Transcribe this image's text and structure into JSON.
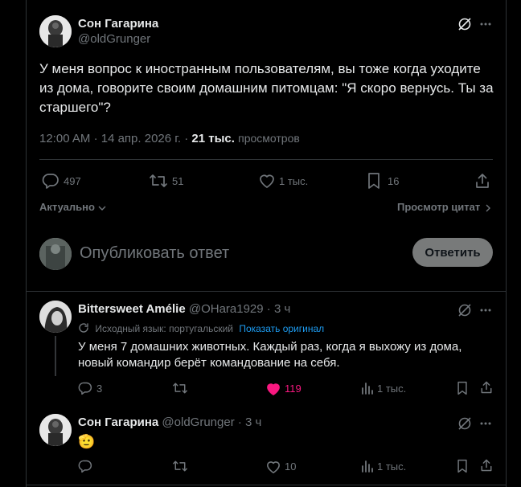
{
  "post": {
    "author_name": "Сон Гагарина",
    "author_handle": "@oldGrunger",
    "text": "У меня вопрос к иностранным пользователям, вы тоже когда уходите из дома, говорите своим домашним питомцам: \"Я скоро вернусь. Ты за старшего\"?",
    "time": "12:00 AM",
    "date": "14 апр. 2026 г.",
    "views_count": "21 тыс.",
    "views_label": "просмотров",
    "stats": {
      "replies": "497",
      "reposts": "51",
      "likes": "1 тыс.",
      "bookmarks": "16"
    },
    "sort_label": "Актуально",
    "quotes_label": "Просмотр цитат"
  },
  "composer": {
    "placeholder": "Опубликовать ответ",
    "button_label": "Ответить"
  },
  "replies": [
    {
      "author_name": "Bittersweet Amélie",
      "author_handle": "@OHara1929",
      "time": "3 ч",
      "translation_note": "Исходный язык: португальский",
      "show_original": "Показать оригинал",
      "text": "У меня 7 домашних животных. Каждый раз, когда я выхожу из дома, новый командир берёт командование на себя.",
      "stats": {
        "replies": "3",
        "reposts": "",
        "likes": "119",
        "views": "1 тыс."
      },
      "liked": true
    },
    {
      "author_name": "Сон Гагарина",
      "author_handle": "@oldGrunger",
      "time": "3 ч",
      "text": "🫡",
      "stats": {
        "replies": "",
        "reposts": "",
        "likes": "10",
        "views": "1 тыс."
      },
      "liked": false
    }
  ],
  "colors": {
    "background": "#000000",
    "text": "#e7e9ea",
    "muted": "#71767b",
    "link": "#1d9bf0",
    "like_active": "#f91880",
    "divider": "#2f3336"
  },
  "icons": [
    "grok-icon",
    "more-icon",
    "reply-icon",
    "repost-icon",
    "like-icon",
    "bookmark-icon",
    "share-icon",
    "views-icon",
    "translate-icon",
    "chevron-down-icon",
    "chevron-right-icon"
  ]
}
